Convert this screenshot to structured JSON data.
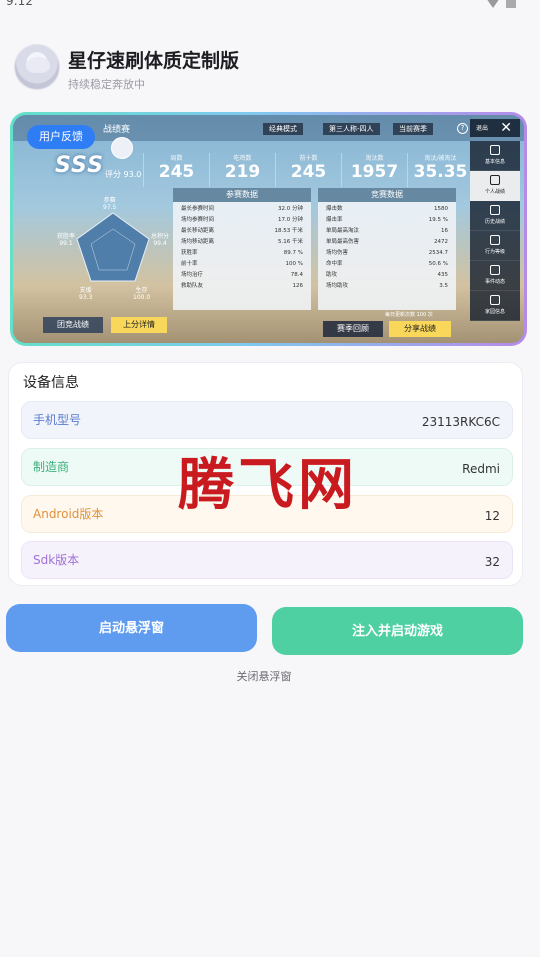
{
  "status_bar": {
    "time": "9:12"
  },
  "header": {
    "title": "星仔速刷体质定制版",
    "subtitle": "持续稳定奔放中"
  },
  "game_preview": {
    "feedback_chip": "用户反馈",
    "player_name": "战绩赛",
    "dropdowns": [
      "经典模式",
      "第三人称-四人",
      "当前赛季"
    ],
    "close_label": "退出",
    "rank": "SSS",
    "score": "评分 93.0",
    "stats": [
      {
        "label": "局数",
        "value": "245"
      },
      {
        "label": "吃鸡数",
        "value": "219"
      },
      {
        "label": "前十数",
        "value": "245"
      },
      {
        "label": "淘汰数",
        "value": "1957"
      },
      {
        "label": "淘汰/被淘汰",
        "value": "35.35"
      }
    ],
    "radar_labels": [
      {
        "name": "参赛",
        "value": "97.5"
      },
      {
        "name": "总积分",
        "value": "99.4"
      },
      {
        "name": "生存",
        "value": "100.0"
      },
      {
        "name": "支援",
        "value": "93.3"
      },
      {
        "name": "获胜率",
        "value": "99.1"
      }
    ],
    "panel_left": {
      "title": "参赛数据",
      "rows": [
        {
          "k": "最长参赛时间",
          "v": "32.0 分钟"
        },
        {
          "k": "场均参赛时间",
          "v": "17.0 分钟"
        },
        {
          "k": "最长移动距离",
          "v": "18.53 千米"
        },
        {
          "k": "场均移动距离",
          "v": "5.16 千米"
        },
        {
          "k": "获胜率",
          "v": "89.7 %"
        },
        {
          "k": "前十率",
          "v": "100 %"
        },
        {
          "k": "场均治疗",
          "v": "78.4"
        },
        {
          "k": "救助队友",
          "v": "126"
        }
      ]
    },
    "panel_right": {
      "title": "竞赛数据",
      "rows": [
        {
          "k": "爆击数",
          "v": "1580"
        },
        {
          "k": "爆击率",
          "v": "19.5 %"
        },
        {
          "k": "单局最高淘汰",
          "v": "16"
        },
        {
          "k": "单局最高伤害",
          "v": "2472"
        },
        {
          "k": "场均伤害",
          "v": "2534.7"
        },
        {
          "k": "命中率",
          "v": "50.6 %"
        },
        {
          "k": "助攻",
          "v": "435"
        },
        {
          "k": "场均助攻",
          "v": "3.5"
        }
      ]
    },
    "side_menu": [
      "基本信息",
      "个人战绩",
      "历史战绩",
      "行为等级",
      "事件动态",
      "家园信息"
    ],
    "buttons": {
      "team": "团竞战绩",
      "detail": "上分详情",
      "season": "赛季回顾",
      "share": "分享战绩"
    },
    "footnote": "每日更新次数 100 次"
  },
  "device": {
    "title": "设备信息",
    "rows": [
      {
        "label": "手机型号",
        "value": "23113RKC6C"
      },
      {
        "label": "制造商",
        "value": "Redmi"
      },
      {
        "label": "Android版本",
        "value": "12"
      },
      {
        "label": "Sdk版本",
        "value": "32"
      }
    ]
  },
  "watermark": "腾飞网",
  "actions": {
    "float": "启动悬浮窗",
    "inject": "注入并启动游戏",
    "close_float": "关闭悬浮窗"
  },
  "colors": {
    "float_button": "#5f9cf0",
    "inject_button": "#4fd0a3",
    "watermark": "#c91a1f",
    "chip": "#2f7df5"
  }
}
